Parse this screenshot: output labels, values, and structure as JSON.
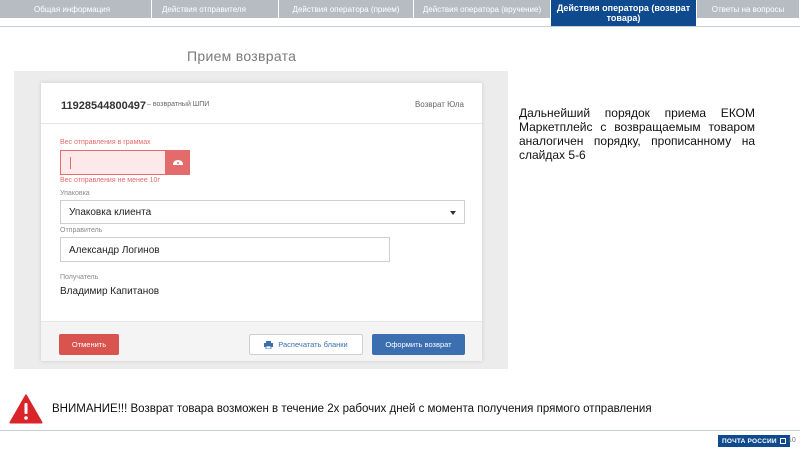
{
  "tabs": [
    {
      "label": "Общая информация"
    },
    {
      "label": "Действия отправителя"
    },
    {
      "label": "Действия оператора (прием)"
    },
    {
      "label": "Действия оператора (вручение)"
    },
    {
      "label": "Действия оператора (возврат товара)"
    },
    {
      "label": "Ответы на вопросы"
    }
  ],
  "page_title": "Прием возврата",
  "card": {
    "tracking_number": "11928544800497",
    "tracking_type": "– возвратный ШПИ",
    "return_label": "Возврат Юла",
    "weight_label": "Вес отправления в граммах",
    "weight_value": "",
    "weight_error": "Вес отправления не менее 10г",
    "packaging_label": "Упаковка",
    "packaging_value": "Упаковка клиента",
    "sender_label": "Отправитель",
    "sender_value": "Александр Логинов",
    "recipient_label": "Получатель",
    "recipient_value": "Владимир Капитанов",
    "cancel_label": "Отменить",
    "print_label": "Распечатать бланки",
    "submit_label": "Оформить возврат"
  },
  "description": "Дальнейший порядок приема ЕКОМ Маркетплейс с возвращаемым товаром аналогичен порядку, прописанному на слайдах 5-6",
  "warning": "ВНИМАНИЕ!!! Возврат товара возможен в течение 2х рабочих дней с момента получения прямого отправления",
  "logo_text": "ПОЧТА РОССИИ",
  "page_number": "10",
  "colors": {
    "brand": "#0f4a8e",
    "error": "#e36b6b",
    "cancel": "#d9534f",
    "primary": "#3b6fb0",
    "warning": "#d9252a"
  },
  "icons": {
    "weight_button": "scale-icon",
    "print_button": "printer-icon",
    "warning": "warning-triangle-icon"
  }
}
